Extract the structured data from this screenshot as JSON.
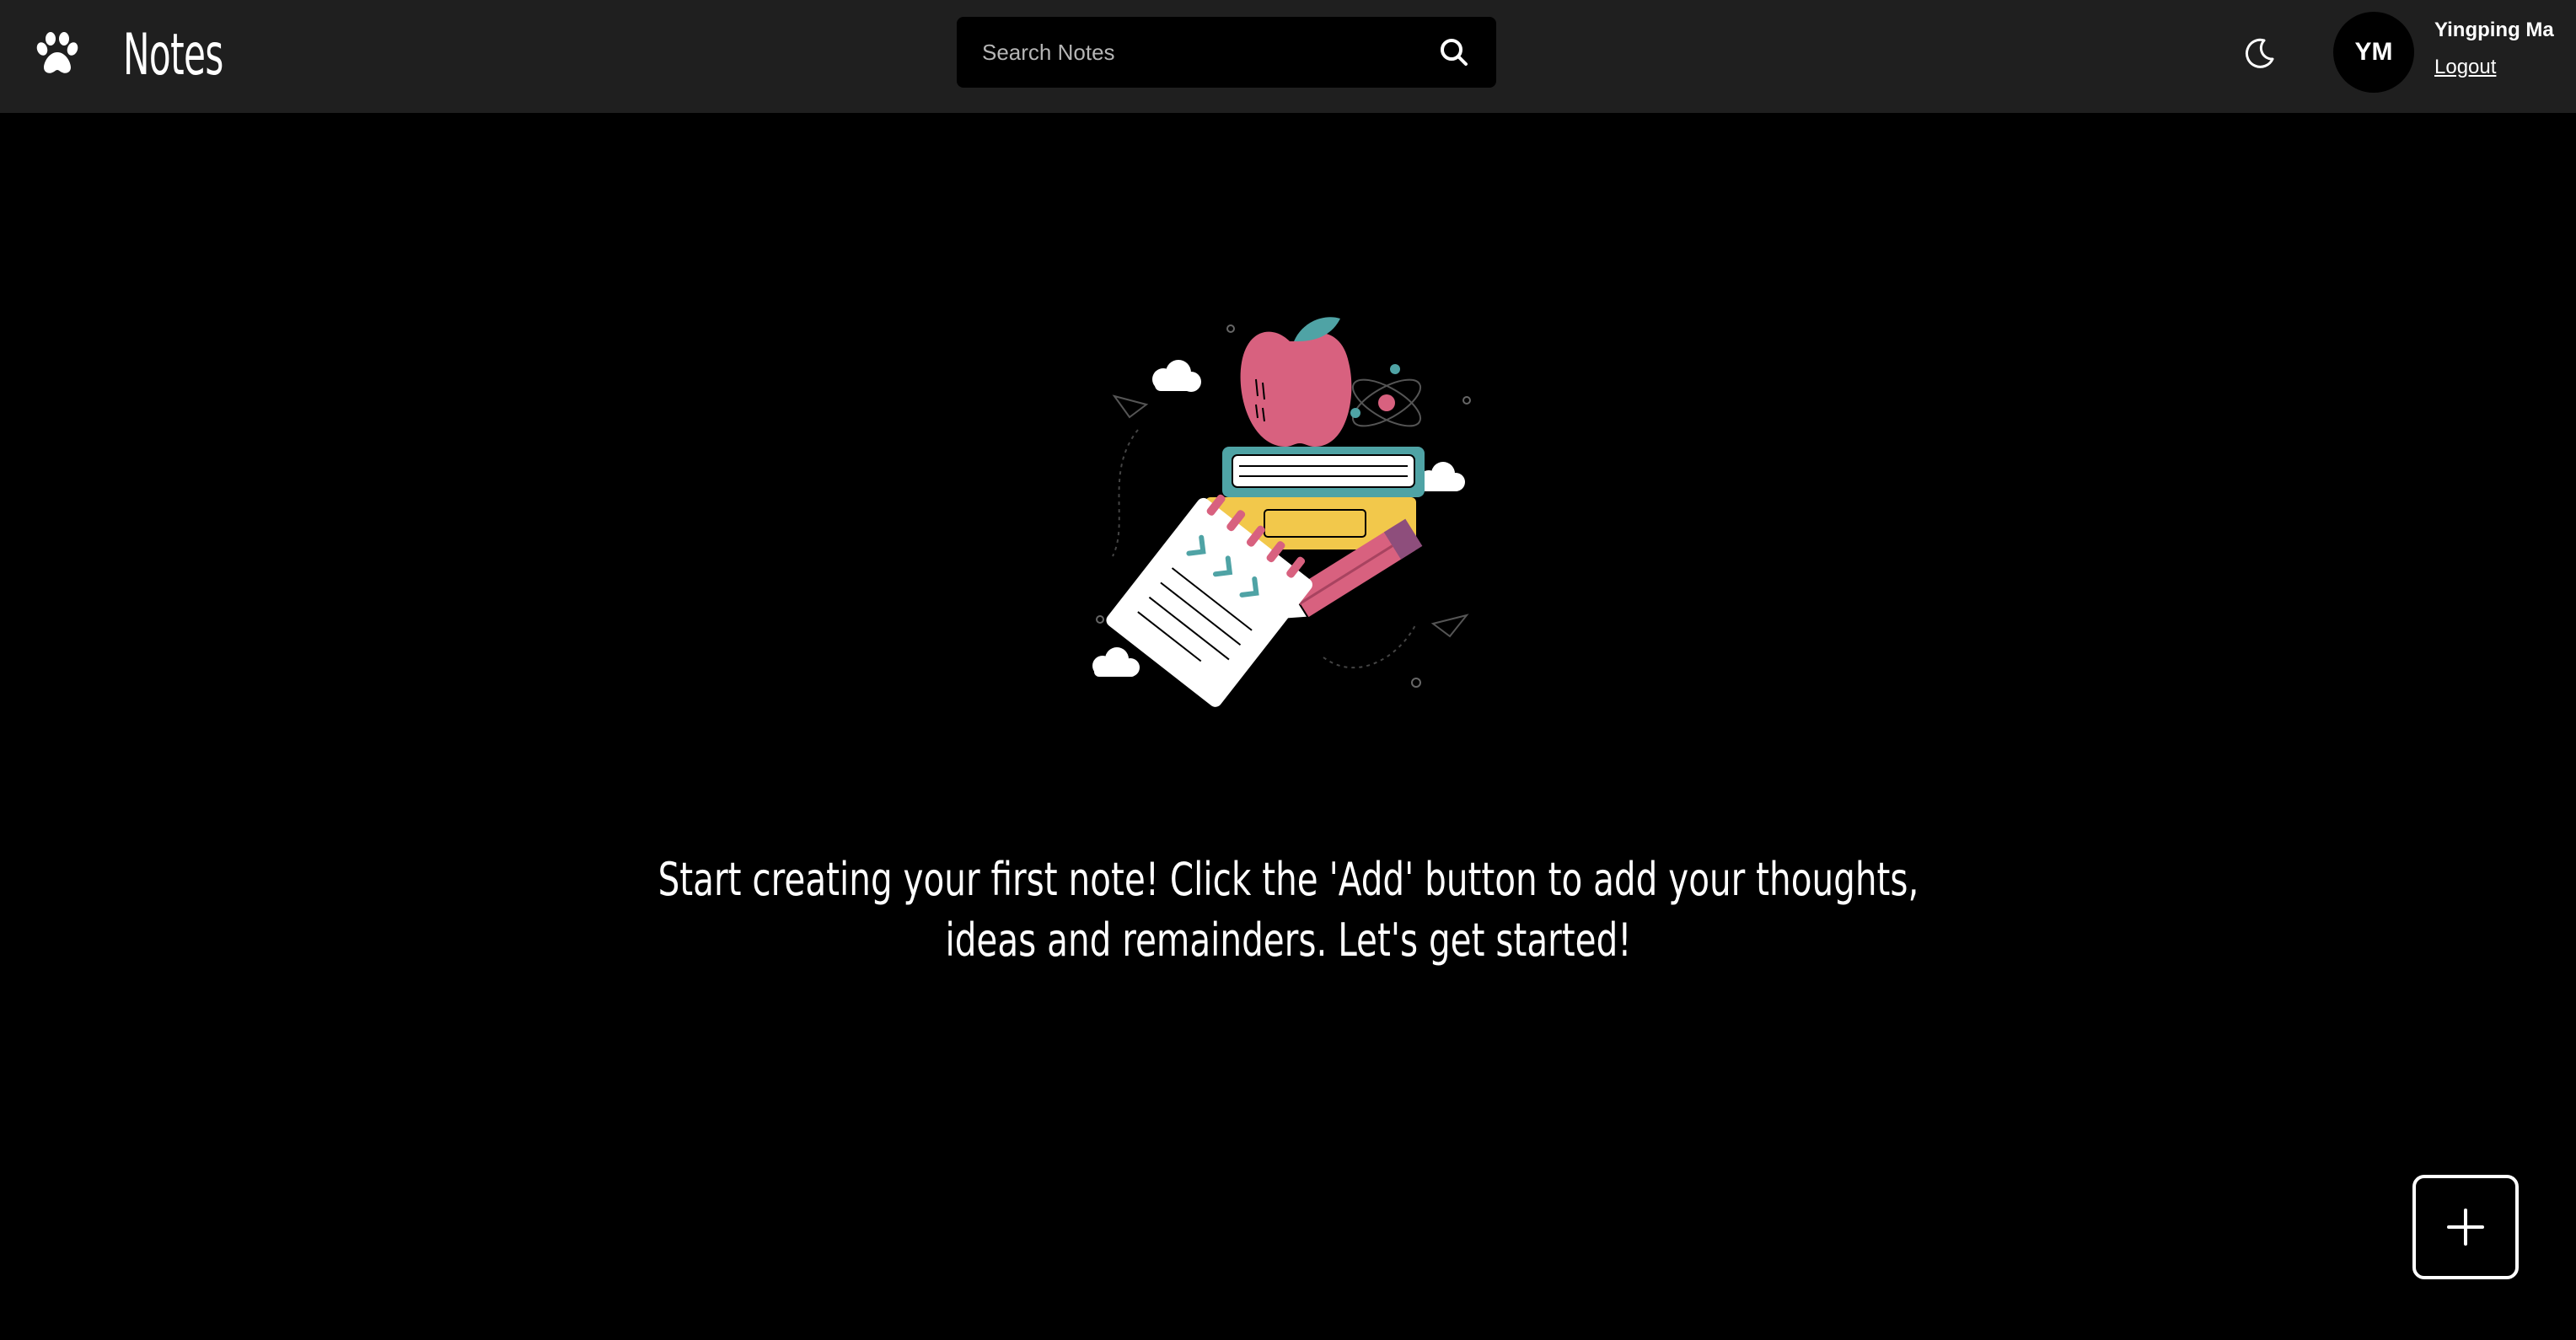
{
  "header": {
    "logo_icon": "paw-icon",
    "title": "Notes",
    "search": {
      "placeholder": "Search Notes",
      "value": "",
      "icon": "search-icon"
    },
    "theme_toggle_icon": "moon-icon",
    "user": {
      "initials": "YM",
      "name": "Yingping Ma",
      "logout_label": "Logout"
    }
  },
  "main": {
    "illustration": "books-apple-notepad-pencil-illustration",
    "empty_message": "Start creating your first note! Click the 'Add' button to add your thoughts, ideas and remainders. Let's get started!"
  },
  "fab": {
    "icon": "plus-icon"
  },
  "colors": {
    "page_background": "#000000",
    "navbar_background": "#1f1f1f",
    "text": "#ffffff",
    "apple": "#d8617f",
    "book_teal": "#4fa3a5",
    "book_yellow": "#f2c84b",
    "pencil_plum": "#8e4e7c"
  }
}
